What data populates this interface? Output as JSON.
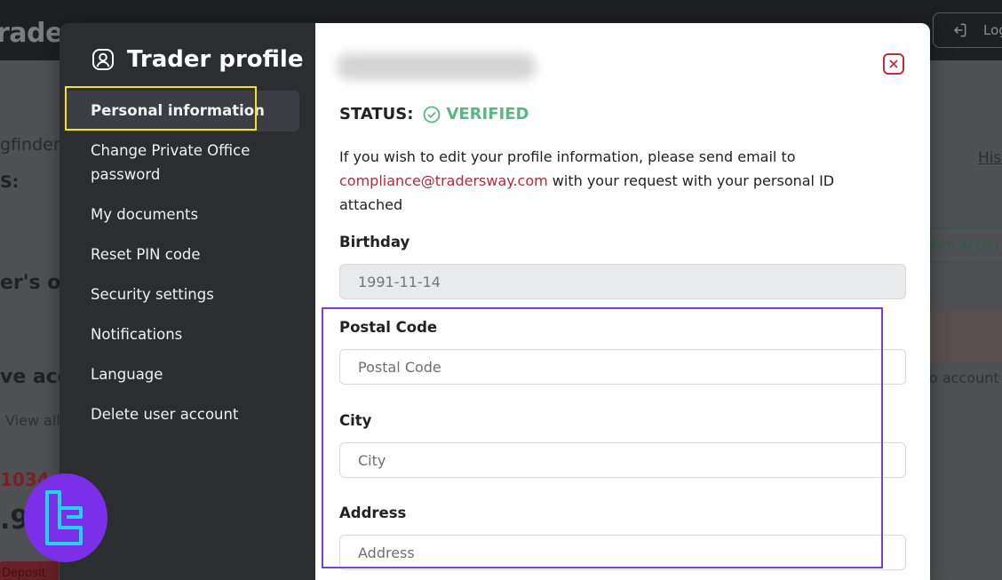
{
  "background": {
    "logo_fragment": "rader",
    "logout_fragment": "Log",
    "history_fragment": "Hist",
    "username_fragment": "gfinder",
    "status_fragment": "S:",
    "office_fragment": "er's of",
    "accounts_fragment": "ve acc",
    "view_all_fragment": "View all",
    "no_account_fragment": "o account",
    "green_button_fragment": "een Accou",
    "account_number_fragment": "1034",
    "balance_fragment": ".9",
    "deposit_fragment": "Deposit"
  },
  "sidebar": {
    "title": "Trader profile",
    "items": [
      {
        "label": "Personal information",
        "active": true
      },
      {
        "label": "Change Private Office password",
        "active": false
      },
      {
        "label": "My documents",
        "active": false
      },
      {
        "label": "Reset PIN code",
        "active": false
      },
      {
        "label": "Security settings",
        "active": false
      },
      {
        "label": "Notifications",
        "active": false
      },
      {
        "label": "Language",
        "active": false
      },
      {
        "label": "Delete user account",
        "active": false
      }
    ]
  },
  "main": {
    "status_label": "STATUS:",
    "status_value": "VERIFIED",
    "info_text_before": "If you wish to edit your profile information, please send email to",
    "info_email": "compliance@tradersway.com",
    "info_text_after": " with your request with your personal ID attached",
    "fields": {
      "birthday": {
        "label": "Birthday",
        "value": "1991-11-14"
      },
      "postal_code": {
        "label": "Postal Code",
        "placeholder": "Postal Code",
        "value": ""
      },
      "city": {
        "label": "City",
        "placeholder": "City",
        "value": ""
      },
      "address": {
        "label": "Address",
        "placeholder": "Address",
        "value": ""
      }
    }
  },
  "colors": {
    "verified": "#5cb585",
    "link": "#b52a37",
    "highlight_yellow": "#f4e614",
    "highlight_purple": "#7a3fd6",
    "sidebar_bg": "#2b2d31"
  },
  "icons": [
    "user-circle-icon",
    "check-circle-icon",
    "close-icon",
    "logout-icon",
    "watermark-logo"
  ]
}
